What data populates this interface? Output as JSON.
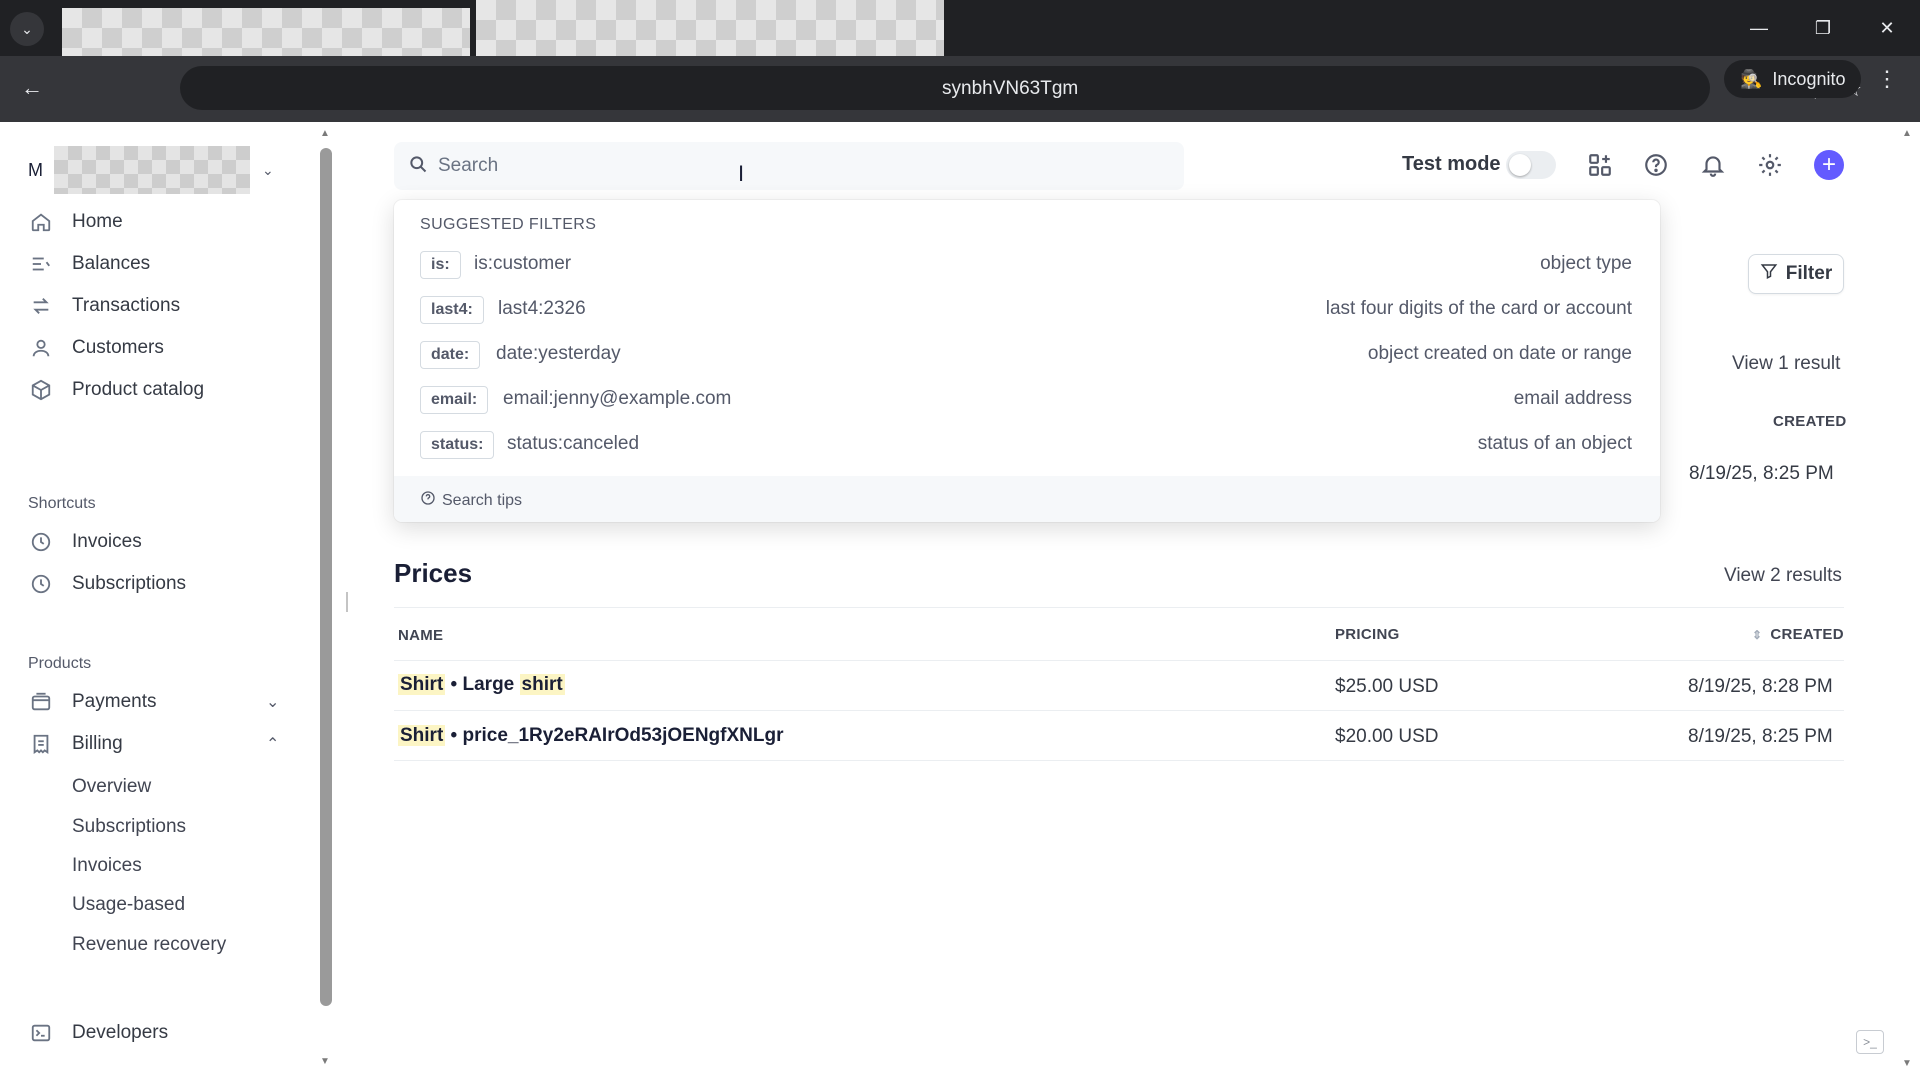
{
  "browser": {
    "url_fragment": "synbhVN63Tgm",
    "incognito_label": "Incognito"
  },
  "sidebar": {
    "account_letter": "M",
    "main_items": [
      {
        "label": "Home",
        "icon": "home-icon"
      },
      {
        "label": "Balances",
        "icon": "balances-icon"
      },
      {
        "label": "Transactions",
        "icon": "transactions-icon"
      },
      {
        "label": "Customers",
        "icon": "customers-icon"
      },
      {
        "label": "Product catalog",
        "icon": "product-catalog-icon"
      }
    ],
    "shortcuts_heading": "Shortcuts",
    "shortcuts": [
      {
        "label": "Invoices",
        "icon": "clock-icon"
      },
      {
        "label": "Subscriptions",
        "icon": "clock-icon"
      }
    ],
    "products_heading": "Products",
    "products": [
      {
        "label": "Payments",
        "icon": "payments-icon",
        "chevron": "down"
      },
      {
        "label": "Billing",
        "icon": "billing-icon",
        "chevron": "up"
      }
    ],
    "billing_subitems": [
      "Overview",
      "Subscriptions",
      "Invoices",
      "Usage-based",
      "Revenue recovery"
    ],
    "developers_label": "Developers"
  },
  "topbar": {
    "search_placeholder": "Search",
    "test_mode_label": "Test mode",
    "test_mode_on": false
  },
  "dropdown": {
    "title": "SUGGESTED FILTERS",
    "filters": [
      {
        "key": "is:",
        "example": "is:customer",
        "description": "object type"
      },
      {
        "key": "last4:",
        "example": "last4:2326",
        "description": "last four digits of the card or account"
      },
      {
        "key": "date:",
        "example": "date:yesterday",
        "description": "object created on date or range"
      },
      {
        "key": "email:",
        "example": "email:jenny@example.com",
        "description": "email address"
      },
      {
        "key": "status:",
        "example": "status:canceled",
        "description": "status of an object"
      }
    ],
    "search_tips": "Search tips"
  },
  "background": {
    "filter_label": "Filter",
    "products_view": "View 1 result",
    "products_created_header": "CREATED",
    "products_created_value": "8/19/25, 8:25 PM"
  },
  "prices": {
    "title": "Prices",
    "view_link": "View 2 results",
    "headers": {
      "name": "NAME",
      "pricing": "PRICING",
      "created": "CREATED"
    },
    "rows": [
      {
        "name_hl": "Shirt",
        "separator": " • ",
        "name_rest": "Large ",
        "name_hl2": "shirt",
        "pricing": "$25.00 USD",
        "created": "8/19/25, 8:28 PM"
      },
      {
        "name_hl": "Shirt",
        "separator": " • ",
        "name_rest": "price_1Ry2eRAIrOd53jOENgfXNLgr",
        "name_hl2": "",
        "pricing": "$20.00 USD",
        "created": "8/19/25, 8:25 PM"
      }
    ]
  },
  "colors": {
    "accent": "#635bff",
    "highlight": "#fcf5c4"
  }
}
